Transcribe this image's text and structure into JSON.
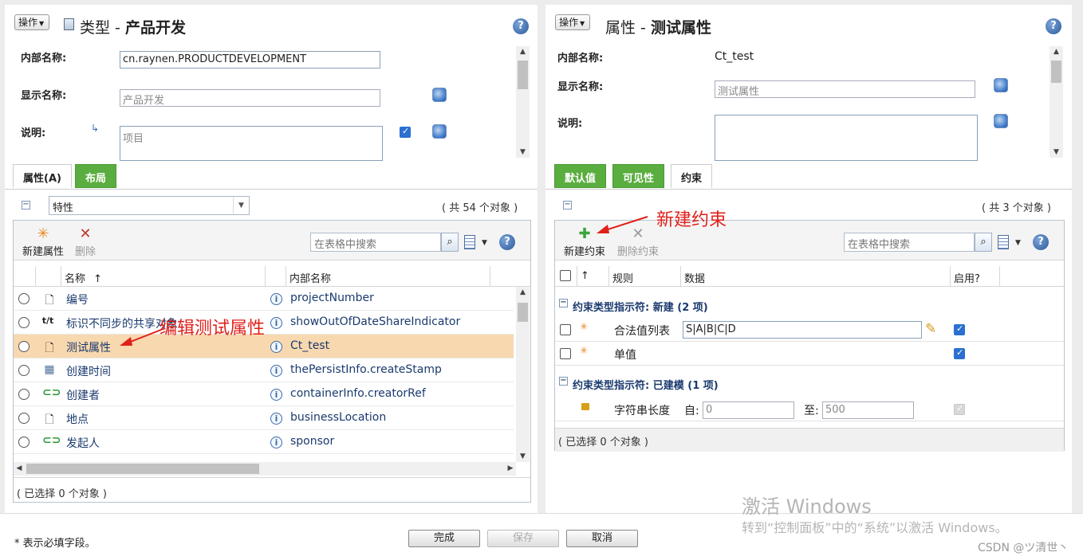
{
  "left": {
    "actions_label": "操作",
    "title_prefix": "类型 - ",
    "title_bold": "产品开发",
    "form": {
      "internal_name_label": "内部名称:",
      "internal_name_value": "cn.raynen.PRODUCTDEVELOPMENT",
      "display_name_label": "显示名称:",
      "display_name_value": "产品开发",
      "description_label": "说明:",
      "description_value": "项目"
    },
    "tabs": [
      "属性(A)",
      "布局"
    ],
    "filter_value": "特性",
    "count_text": "( 共 54 个对象 )",
    "toolbar": {
      "new_label": "新建属性",
      "delete_label": "删除",
      "search_placeholder": "在表格中搜索"
    },
    "columns": {
      "name": "名称",
      "internal": "内部名称"
    },
    "rows": [
      {
        "icon": "document-icon",
        "name": "编号",
        "internal": "projectNumber"
      },
      {
        "icon": "text-format-icon",
        "name": "标识不同步的共享对象",
        "internal": "showOutOfDateShareIndicator"
      },
      {
        "icon": "document-icon",
        "name": "测试属性",
        "internal": "Ct_test"
      },
      {
        "icon": "calendar-icon",
        "name": "创建时间",
        "internal": "thePersistInfo.createStamp"
      },
      {
        "icon": "reference-icon",
        "name": "创建者",
        "internal": "containerInfo.creatorRef"
      },
      {
        "icon": "document-icon",
        "name": "地点",
        "internal": "businessLocation"
      },
      {
        "icon": "reference-icon",
        "name": "发起人",
        "internal": "sponsor"
      }
    ],
    "status": "( 已选择 0 个对象 )",
    "annotation": "编辑测试属性"
  },
  "right": {
    "actions_label": "操作",
    "title_prefix": "属性 - ",
    "title_bold": "测试属性",
    "form": {
      "internal_name_label": "内部名称:",
      "internal_name_value": "Ct_test",
      "display_name_label": "显示名称:",
      "display_name_value": "测试属性",
      "description_label": "说明:"
    },
    "tabs": [
      "默认值",
      "可见性",
      "约束"
    ],
    "count_text": "( 共 3 个对象 )",
    "toolbar": {
      "new_label": "新建约束",
      "delete_label": "删除约束",
      "search_placeholder": "在表格中搜索"
    },
    "columns": {
      "sort": "↑",
      "rule": "规则",
      "data": "数据",
      "enabled": "启用?"
    },
    "groups": [
      {
        "title": "约束类型指示符: 新建 (2 项)",
        "rows": [
          {
            "rule": "合法值列表",
            "data": "S|A|B|C|D",
            "enabled": true
          },
          {
            "rule": "单值",
            "data": "",
            "enabled": true
          }
        ]
      },
      {
        "title": "约束类型指示符: 已建模 (1 项)",
        "rows": [
          {
            "rule": "字符串长度",
            "from_label": "自:",
            "from_value": "0",
            "to_label": "至:",
            "to_value": "500",
            "enabled": true
          }
        ]
      }
    ],
    "status": "( 已选择 0 个对象 )",
    "annotation": "新建约束"
  },
  "footer": {
    "required_note": "* 表示必填字段。",
    "buttons": {
      "finish": "完成",
      "save": "保存",
      "cancel": "取消"
    }
  },
  "watermark": {
    "line1": "激活 Windows",
    "line2": "转到“控制面板”中的“系统”以激活 Windows。",
    "credit": "CSDN @ツ清世丶"
  }
}
